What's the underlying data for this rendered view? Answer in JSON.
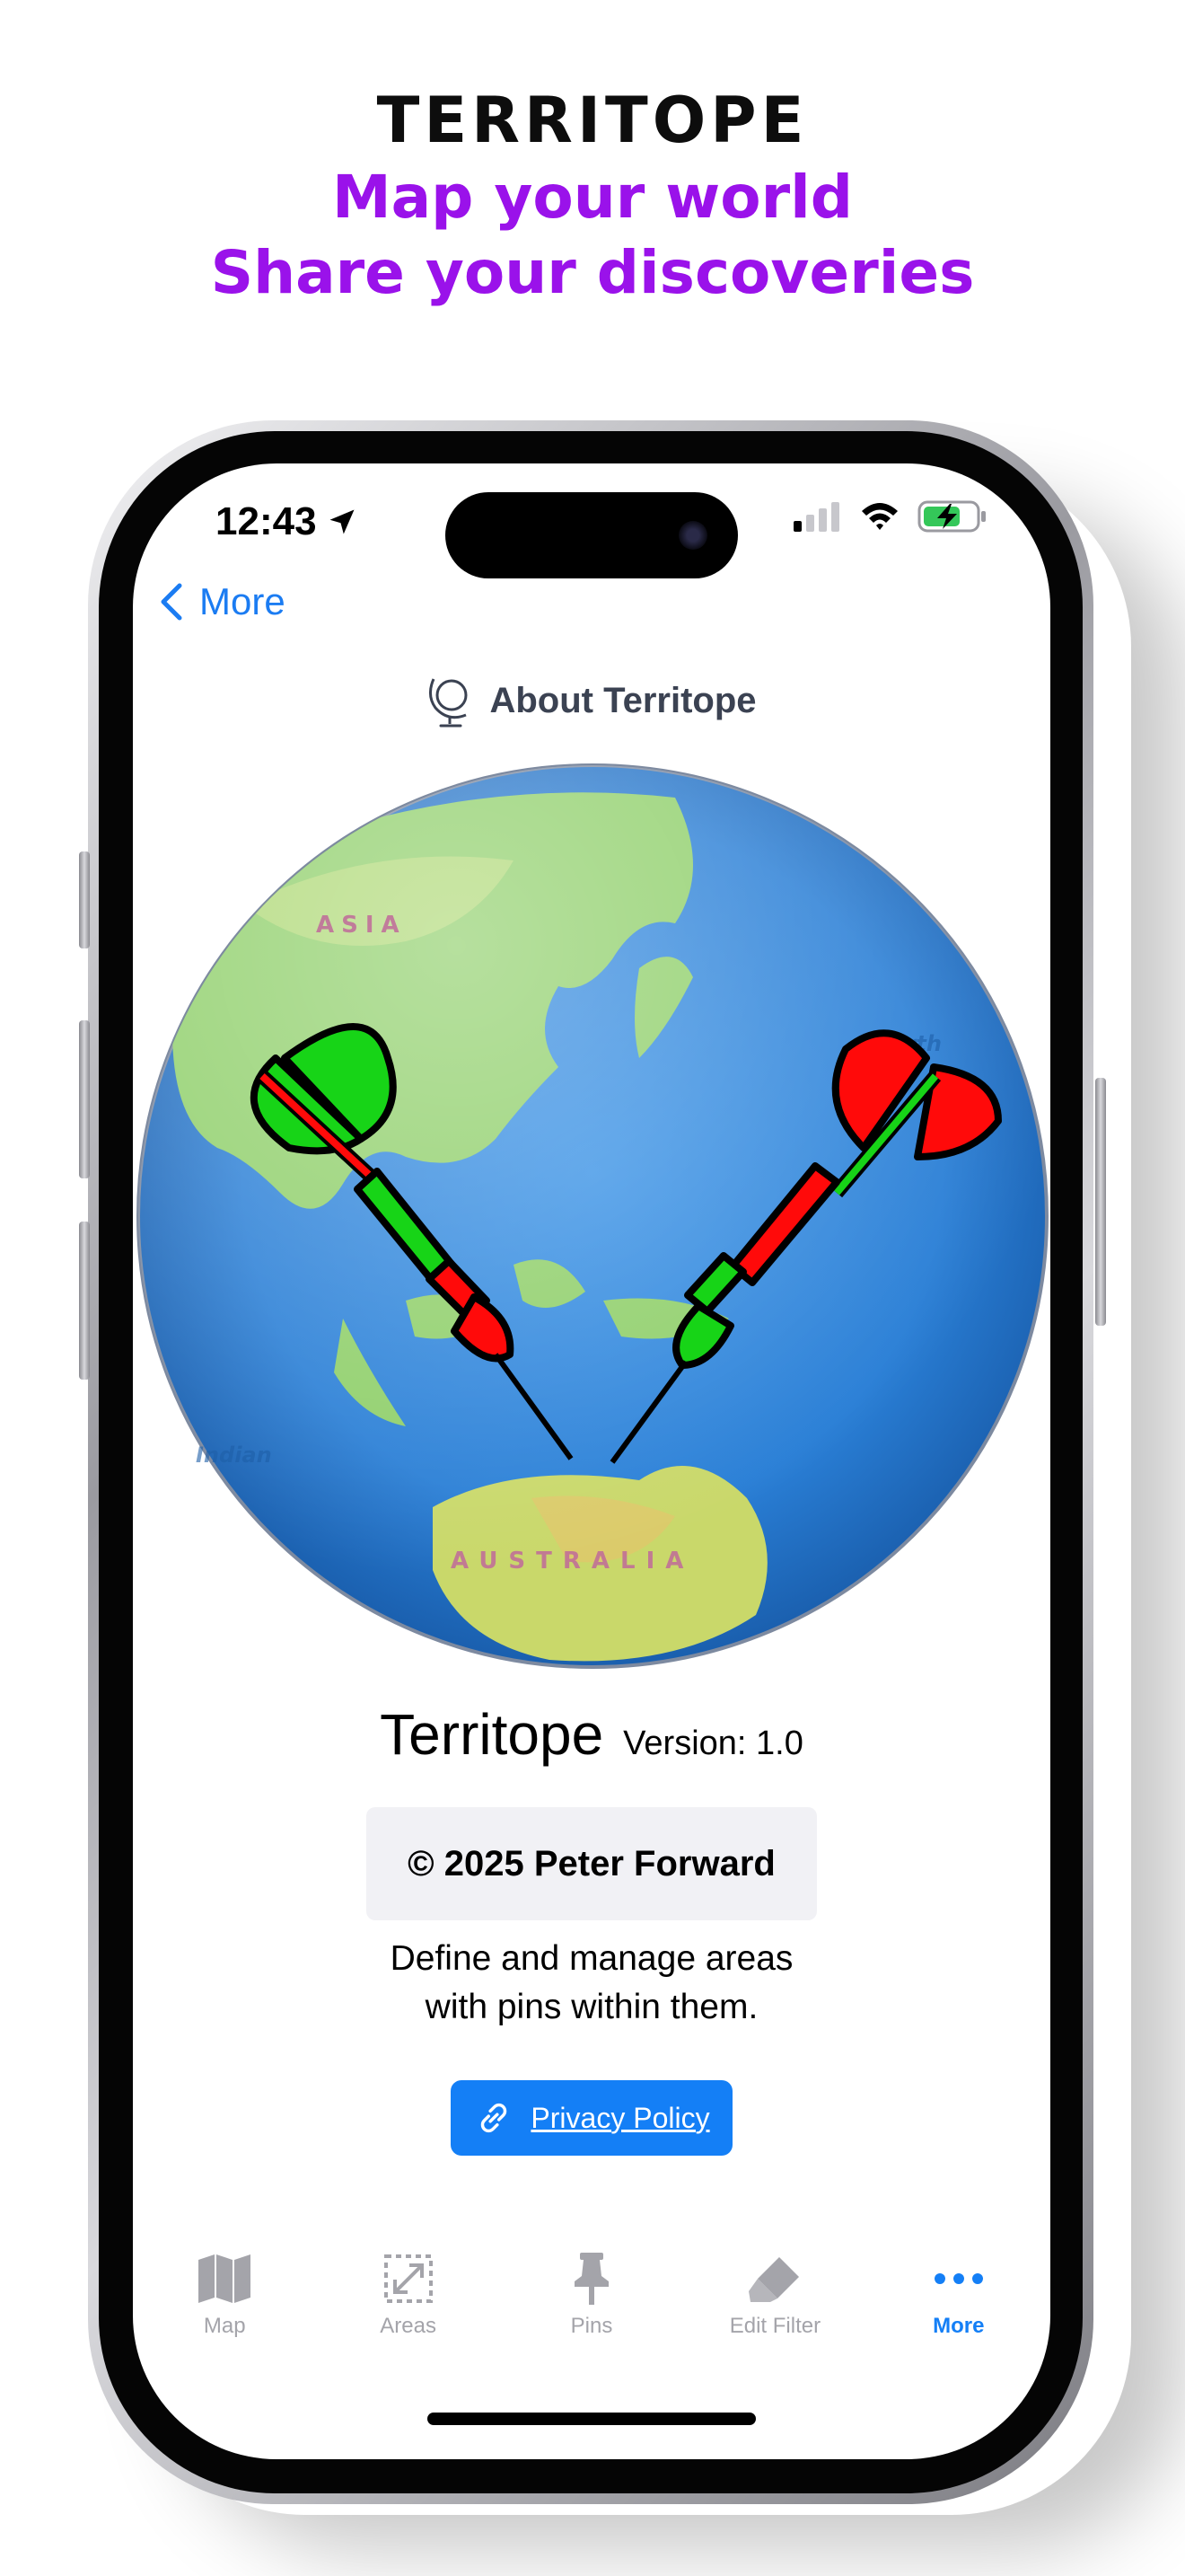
{
  "promo": {
    "brand": "TERRITOPE",
    "tagline_1": "Map your world",
    "tagline_2": "Share your discoveries"
  },
  "status_bar": {
    "time": "12:43",
    "icons": [
      "location-arrow-icon",
      "cellular-signal-icon",
      "wifi-icon",
      "battery-charging-icon"
    ]
  },
  "nav": {
    "back_label": "More"
  },
  "header": {
    "title": "About Territope",
    "icon": "globe-icon"
  },
  "globe": {
    "labels": [
      "ASIA",
      "North",
      "Indian",
      "AUSTRALIA"
    ]
  },
  "info": {
    "app_name": "Territope",
    "version": "Version: 1.0",
    "copyright": "© 2025 Peter Forward",
    "description_1": "Define and manage areas",
    "description_2": "with pins within them.",
    "privacy_label": "Privacy Policy"
  },
  "tabbar": {
    "tabs": [
      {
        "label": "Map",
        "icon": "map-icon",
        "active": false
      },
      {
        "label": "Areas",
        "icon": "areas-icon",
        "active": false
      },
      {
        "label": "Pins",
        "icon": "pin-icon",
        "active": false
      },
      {
        "label": "Edit Filter",
        "icon": "eraser-icon",
        "active": false
      },
      {
        "label": "More",
        "icon": "more-dots-icon",
        "active": true
      }
    ]
  },
  "colors": {
    "accent": "#147ff6",
    "promo_purple": "#9a12ea",
    "dart_green": "#17d417",
    "dart_red": "#ff0a0a"
  }
}
